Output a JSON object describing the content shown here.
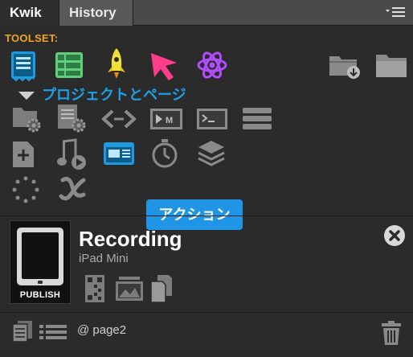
{
  "tabs": [
    {
      "label": "Kwik",
      "active": true
    },
    {
      "label": "History",
      "active": false
    }
  ],
  "panel_menu_icon": "panel-menu-icon",
  "toolset": {
    "label": "TOOLSET:",
    "tools": [
      "project-document-icon",
      "layout-grid-icon",
      "rocket-icon",
      "pointer-arrow-icon",
      "atom-icon"
    ],
    "folder_icons": [
      "folder-download-icon",
      "folder-icon"
    ]
  },
  "section": {
    "label": "プロジェクトとページ",
    "icon_rows": [
      [
        "folder-gear-icon",
        "document-gear-icon",
        "code-arrows-icon",
        "video-clip-icon",
        "terminal-icon",
        "database-stack-icon"
      ],
      [
        "add-document-icon",
        "audio-play-icon",
        "browser-window-icon",
        "stopwatch-icon",
        "layers-icon"
      ],
      [
        "loading-spinner-icon",
        "variable-x-icon"
      ]
    ]
  },
  "tooltip": {
    "label": "アクション"
  },
  "project": {
    "title": "Recording",
    "device": "iPad Mini",
    "publish_label": "PUBLISH",
    "actions": [
      "qr-code-icon",
      "image-gallery-icon",
      "copy-documents-icon"
    ]
  },
  "footer": {
    "page_label": "@ page2",
    "icons": [
      "pages-icon",
      "list-icon",
      "trash-icon"
    ]
  },
  "colors": {
    "accent_blue": "#1ea0e6",
    "toolset_orange": "#f2a420",
    "tooltip_blue": "#2095e6",
    "panel_bg": "#2b2b2b"
  }
}
